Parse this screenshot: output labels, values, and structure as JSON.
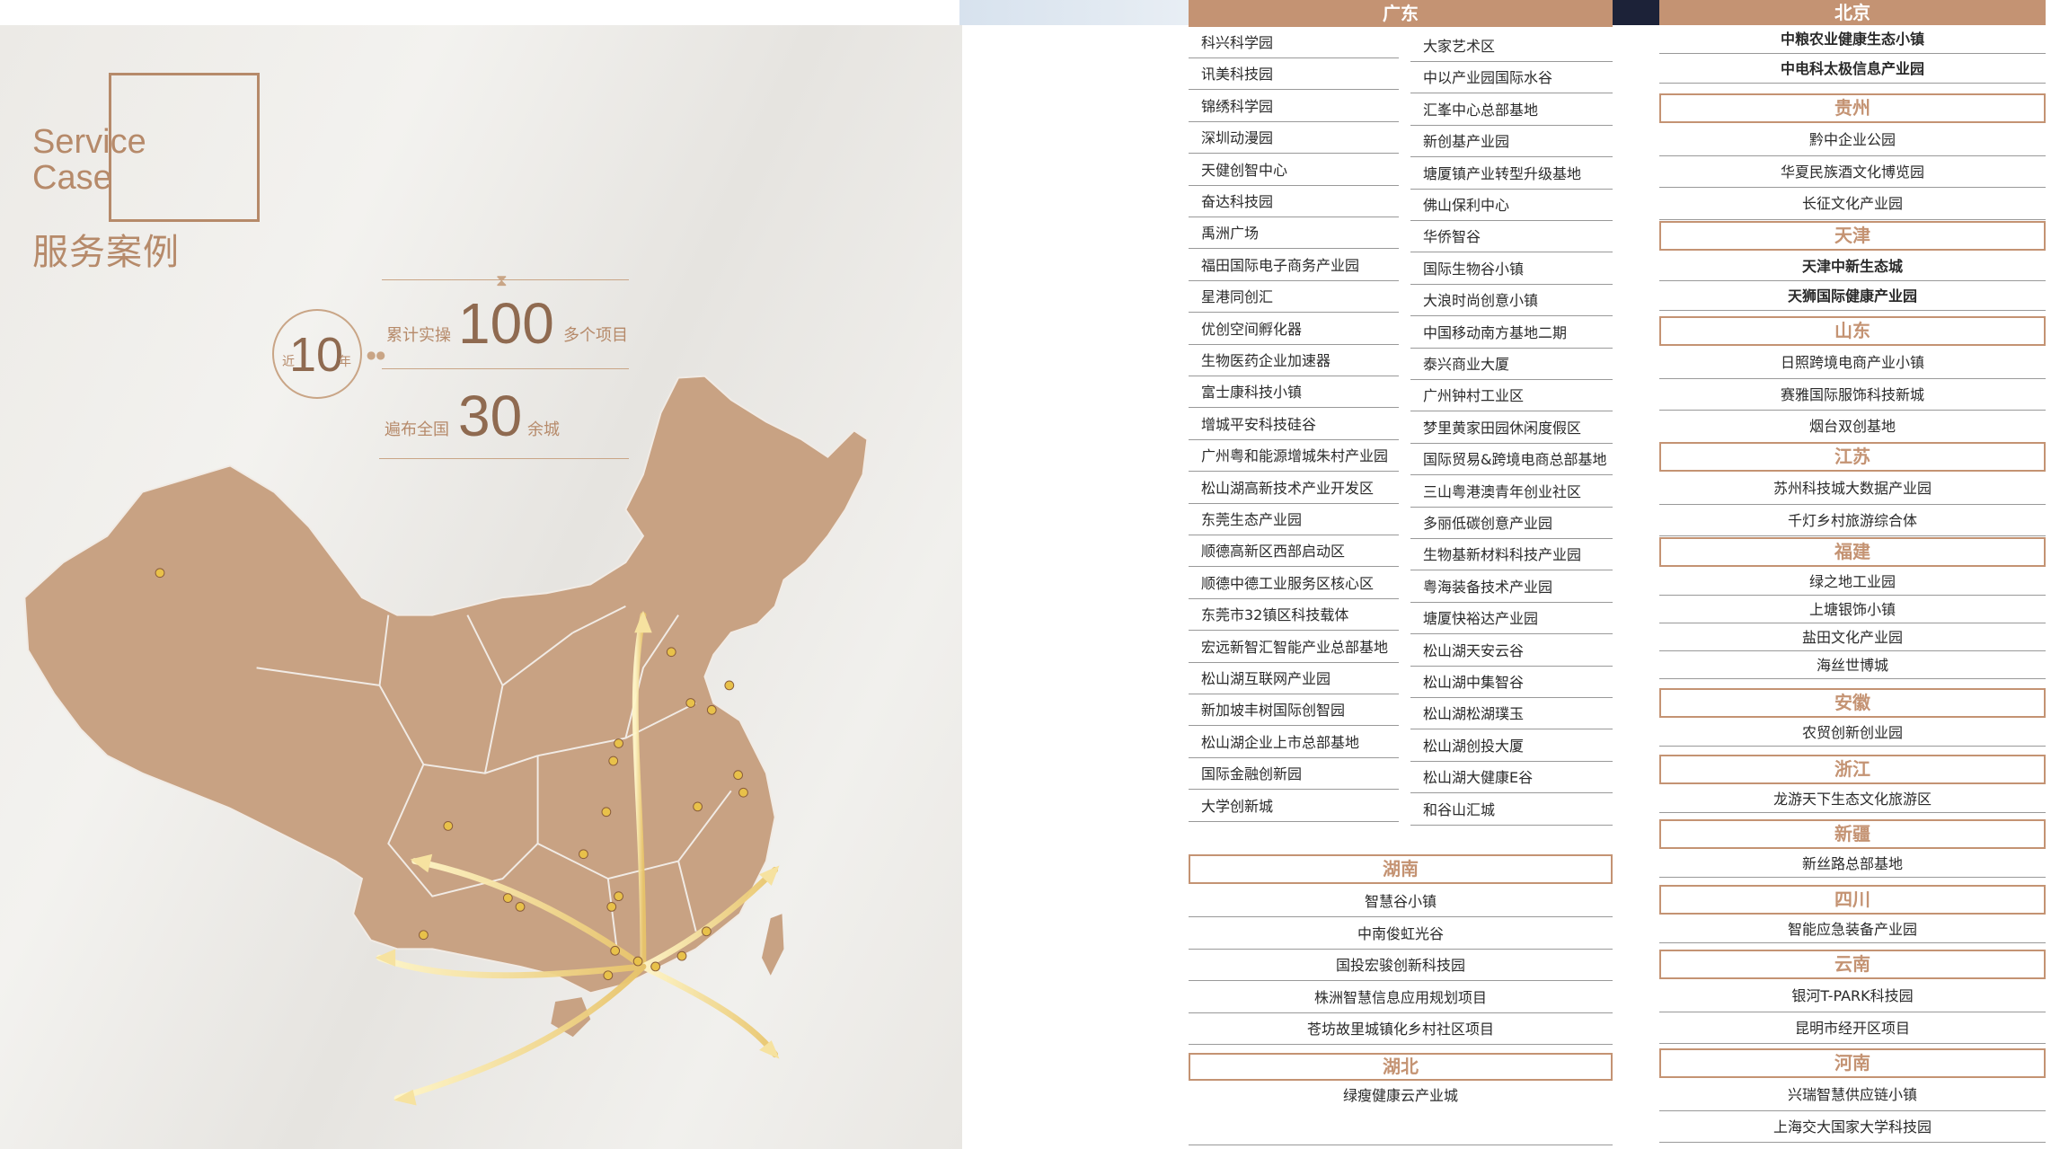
{
  "brand": {
    "service_case": "Service\nCase",
    "title_cn": "服务案例"
  },
  "stats": {
    "near": "近",
    "years": "10",
    "year_unit": "年",
    "projects_prefix": "累计实操",
    "projects_count": "100",
    "projects_suffix": "多个项目",
    "cities_prefix": "遍布全国",
    "cities_count": "30",
    "cities_suffix": "余城"
  },
  "colors": {
    "accent": "#c49373",
    "text": "#2a2a2a"
  },
  "guangdong": {
    "header": "广东",
    "col1": [
      "科兴科学园",
      "讯美科技园",
      "锦绣科学园",
      "深圳动漫园",
      "天健创智中心",
      "奋达科技园",
      "禹洲广场",
      "福田国际电子商务产业园",
      "星港同创汇",
      "优创空间孵化器",
      "生物医药企业加速器",
      "富士康科技小镇",
      "增城平安科技硅谷",
      "广州粤和能源增城朱村产业园",
      "松山湖高新技术产业开发区",
      "东莞生态产业园",
      "顺德高新区西部启动区",
      "顺德中德工业服务区核心区",
      "东莞市32镇区科技载体",
      "宏远新智汇智能产业总部基地",
      "松山湖互联网产业园",
      "新加坡丰树国际创智园",
      "松山湖企业上市总部基地",
      "国际金融创新园",
      "大学创新城"
    ],
    "col2": [
      "大家艺术区",
      "中以产业园国际水谷",
      "汇峯中心总部基地",
      "新创基产业园",
      "塘厦镇产业转型升级基地",
      "佛山保利中心",
      "华侨智谷",
      "国际生物谷小镇",
      "大浪时尚创意小镇",
      "中国移动南方基地二期",
      "泰兴商业大厦",
      "广州钟村工业区",
      "梦里黄家田园休闲度假区",
      "国际贸易&跨境电商总部基地",
      "三山粤港澳青年创业社区",
      "多丽低碳创意产业园",
      "生物基新材料科技产业园",
      "粤海装备技术产业园",
      "塘厦快裕达产业园",
      "松山湖天安云谷",
      "松山湖中集智谷",
      "松山湖松湖璞玉",
      "松山湖创投大厦",
      "松山湖大健康E谷",
      "和谷山汇城"
    ]
  },
  "hunan": {
    "header": "湖南",
    "items": [
      "智慧谷小镇",
      "中南俊虹光谷",
      "国投宏骏创新科技园",
      "株洲智慧信息应用规划项目",
      "苍坊故里城镇化乡村社区项目"
    ]
  },
  "hubei": {
    "header": "湖北",
    "items": [
      "绿瘦健康云产业城"
    ]
  },
  "right_groups": [
    {
      "header": "北京",
      "items": [
        "中粮农业健康生态小镇",
        "中电科太极信息产业园"
      ],
      "bold": true
    },
    {
      "header": "贵州",
      "items": [
        "黔中企业公园",
        "华夏民族酒文化博览园",
        "长征文化产业园"
      ]
    },
    {
      "header": "天津",
      "items": [
        "天津中新生态城",
        "天狮国际健康产业园"
      ],
      "bold": true
    },
    {
      "header": "山东",
      "items": [
        "日照跨境电商产业小镇",
        "赛雅国际服饰科技新城",
        "烟台双创基地"
      ]
    },
    {
      "header": "江苏",
      "items": [
        "苏州科技城大数据产业园",
        "千灯乡村旅游综合体"
      ]
    },
    {
      "header": "福建",
      "items": [
        "绿之地工业园",
        "上塘银饰小镇",
        "盐田文化产业园",
        "海丝世博城"
      ]
    },
    {
      "header": "安徽",
      "items": [
        "农贸创新创业园"
      ]
    },
    {
      "header": "浙江",
      "items": [
        "龙游天下生态文化旅游区"
      ]
    },
    {
      "header": "新疆",
      "items": [
        "新丝路总部基地"
      ]
    },
    {
      "header": "四川",
      "items": [
        "智能应急装备产业园"
      ]
    },
    {
      "header": "云南",
      "items": [
        "银河T-PARK科技园",
        "昆明市经开区项目"
      ]
    },
    {
      "header": "河南",
      "items": [
        "兴瑞智慧供应链小镇",
        "上海交大国家大学科技园"
      ]
    }
  ]
}
